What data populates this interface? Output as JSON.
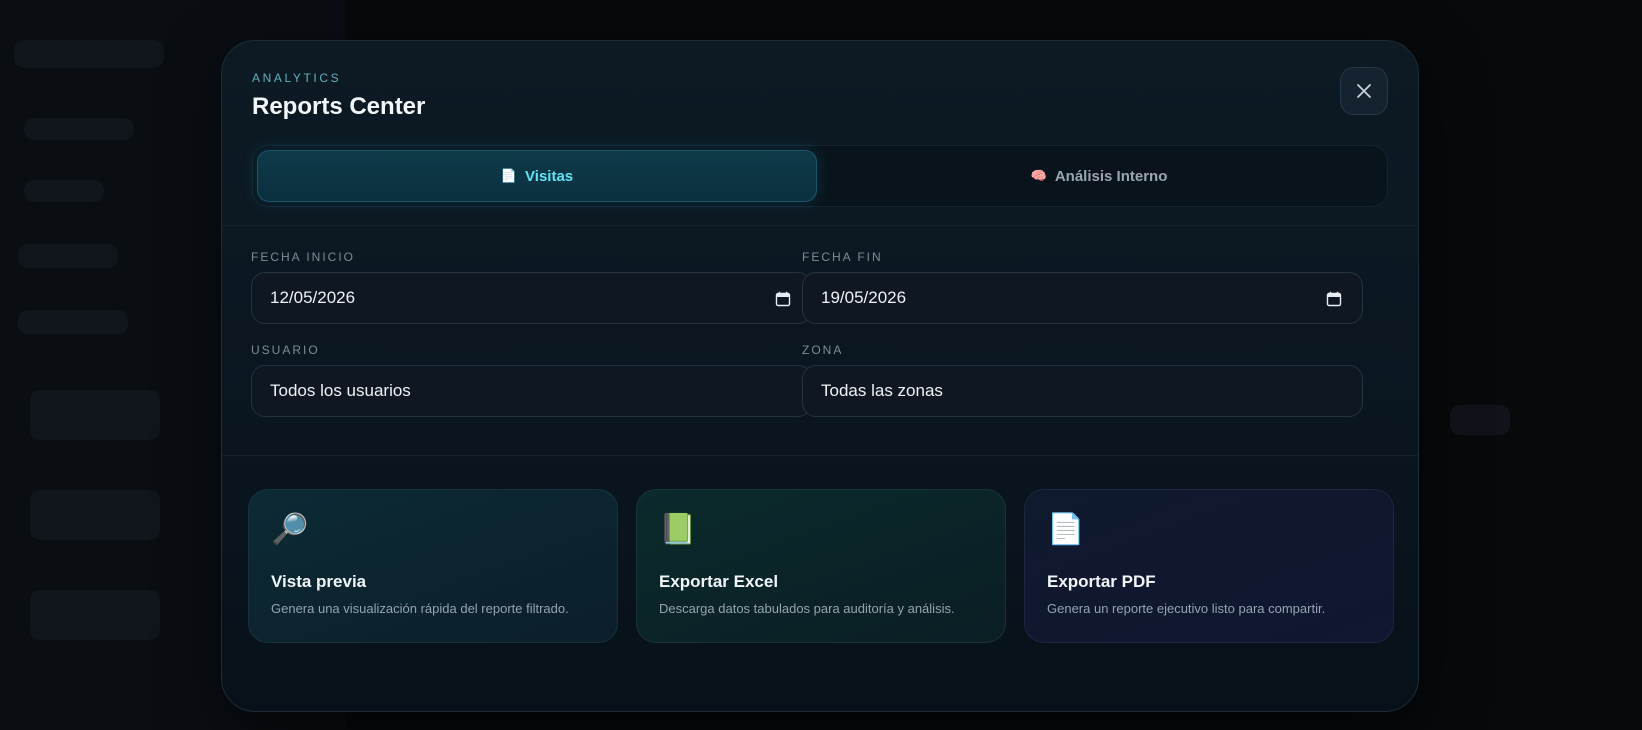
{
  "modal": {
    "eyebrow": "ANALYTICS",
    "title": "Reports Center",
    "close_icon": "close-icon"
  },
  "tabs": [
    {
      "label": "Visitas",
      "icon": "📄",
      "icon_name": "document-icon",
      "active": true
    },
    {
      "label": "Análisis Interno",
      "icon": "🧠",
      "icon_name": "brain-icon",
      "active": false
    }
  ],
  "filters": {
    "fecha_inicio": {
      "label": "FECHA INICIO",
      "value": "12/05/2026",
      "icon": "calendar-icon"
    },
    "fecha_fin": {
      "label": "FECHA FIN",
      "value": "19/05/2026",
      "icon": "calendar-icon"
    },
    "usuario": {
      "label": "USUARIO",
      "value": "Todos los usuarios"
    },
    "zona": {
      "label": "ZONA",
      "value": "Todas las zonas"
    }
  },
  "actions": [
    {
      "title": "Vista previa",
      "description": "Genera una visualización rápida del reporte filtrado.",
      "icon": "🔎",
      "icon_name": "magnifier-icon"
    },
    {
      "title": "Exportar Excel",
      "description": "Descarga datos tabulados para auditoría y análisis.",
      "icon": "📗",
      "icon_name": "green-book-icon"
    },
    {
      "title": "Exportar PDF",
      "description": "Genera un reporte ejecutivo listo para compartir.",
      "icon": "📄",
      "icon_name": "document-icon"
    }
  ],
  "colors": {
    "accent": "#5fe3f2",
    "modal_bg": "#0b1620",
    "eyebrow": "#5fb3bd"
  }
}
